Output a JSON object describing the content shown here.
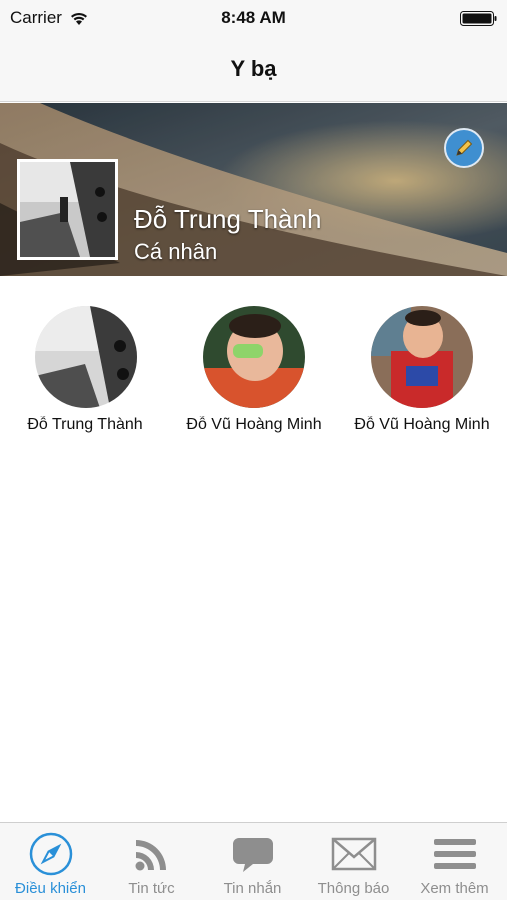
{
  "status_bar": {
    "carrier": "Carrier",
    "time": "8:48 AM"
  },
  "nav": {
    "title": "Y bạ"
  },
  "profile": {
    "name": "Đỗ Trung Thành",
    "subtitle": "Cá nhân"
  },
  "friends": [
    {
      "name": "Đỗ Trung Thành"
    },
    {
      "name": "Đỗ Vũ Hoàng Minh"
    },
    {
      "name": "Đỗ Vũ Hoàng Minh"
    }
  ],
  "tabs": [
    {
      "label": "Điều khiển",
      "icon": "compass-icon",
      "active": true
    },
    {
      "label": "Tin tức",
      "icon": "rss-icon",
      "active": false
    },
    {
      "label": "Tin nhắn",
      "icon": "chat-bubble-icon",
      "active": false
    },
    {
      "label": "Thông báo",
      "icon": "envelope-icon",
      "active": false
    },
    {
      "label": "Xem thêm",
      "icon": "menu-icon",
      "active": false
    }
  ],
  "colors": {
    "accent": "#2a90d8",
    "edit_button": "#3f8fd0",
    "inactive": "#8e8e8e"
  }
}
